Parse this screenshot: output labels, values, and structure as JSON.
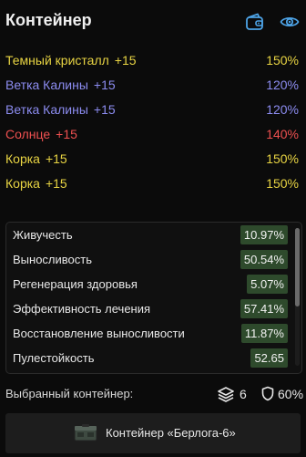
{
  "header": {
    "title": "Контейнер",
    "icons": [
      "wallet-icon",
      "eye-icon"
    ],
    "icon_color": "#4da3e6"
  },
  "items": [
    {
      "name": "Темный кристалл",
      "bonus": "+15",
      "pct": "150%",
      "color": "#e8d443"
    },
    {
      "name": "Ветка Калины",
      "bonus": "+15",
      "pct": "120%",
      "color": "#8c8cf0"
    },
    {
      "name": "Ветка Калины",
      "bonus": "+15",
      "pct": "120%",
      "color": "#8c8cf0"
    },
    {
      "name": "Солнце",
      "bonus": "+15",
      "pct": "140%",
      "color": "#ee5050"
    },
    {
      "name": "Корка",
      "bonus": "+15",
      "pct": "150%",
      "color": "#e8d443"
    },
    {
      "name": "Корка",
      "bonus": "+15",
      "pct": "150%",
      "color": "#e8d443"
    }
  ],
  "stats": [
    {
      "label": "Живучесть",
      "value": "10.97%"
    },
    {
      "label": "Выносливость",
      "value": "50.54%"
    },
    {
      "label": "Регенерация здоровья",
      "value": "5.07%"
    },
    {
      "label": "Эффективность лечения",
      "value": "57.41%"
    },
    {
      "label": "Восстановление выносливости",
      "value": "11.87%"
    },
    {
      "label": "Пулестойкость",
      "value": "52.65"
    }
  ],
  "footer": {
    "selected_label": "Выбранный контейнер:",
    "layers_count": "6",
    "protection": "60%"
  },
  "container_button": {
    "label": "Контейнер «Берлога-6»"
  }
}
